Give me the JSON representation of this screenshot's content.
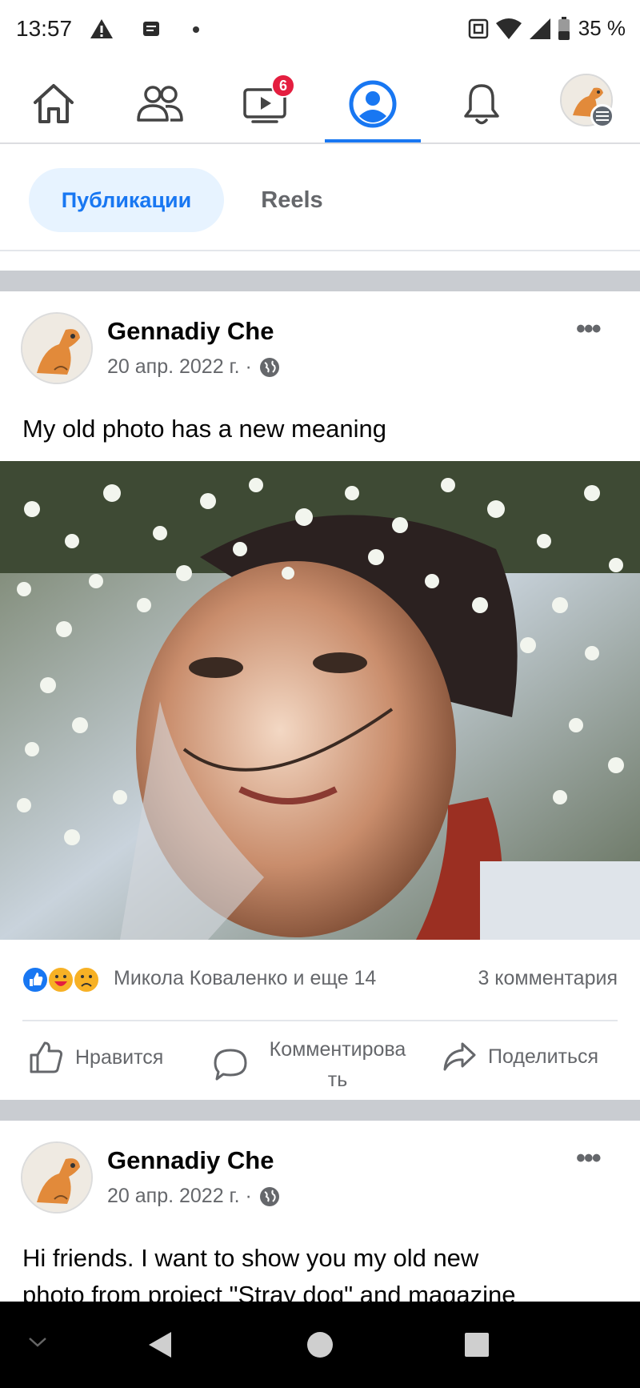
{
  "status_bar": {
    "time": "13:57",
    "battery": "35 %"
  },
  "nav": {
    "items": [
      {
        "icon": "home-icon"
      },
      {
        "icon": "friends-icon"
      },
      {
        "icon": "video-icon",
        "badge": "6"
      },
      {
        "icon": "profile-icon",
        "active": true
      },
      {
        "icon": "bell-icon"
      },
      {
        "icon": "avatar-menu-icon"
      }
    ]
  },
  "tabs": {
    "active": "Публикации",
    "reels": "Reels"
  },
  "posts": [
    {
      "author": "Gennadiy Che",
      "date": "20 апр. 2022 г. ·",
      "text": "My old photo has a new meaning",
      "reactions_text": "Микола Коваленко и еще 14",
      "comments_text": "3 комментария",
      "actions": {
        "like": "Нравится",
        "comment_line1": "Комментирова",
        "comment_line2": "ть",
        "share": "Поделиться"
      }
    },
    {
      "author": "Gennadiy Che",
      "date": "20 апр. 2022 г. ·",
      "text_line1": "Hi friends. I want to show you my old new",
      "text_line2": "photo from project \"Stray dog\" and magazine"
    }
  ],
  "colors": {
    "accent": "#1877f2",
    "badge": "#e41e3f",
    "separator": "#c9ccd1",
    "secondary_text": "#65676b"
  }
}
